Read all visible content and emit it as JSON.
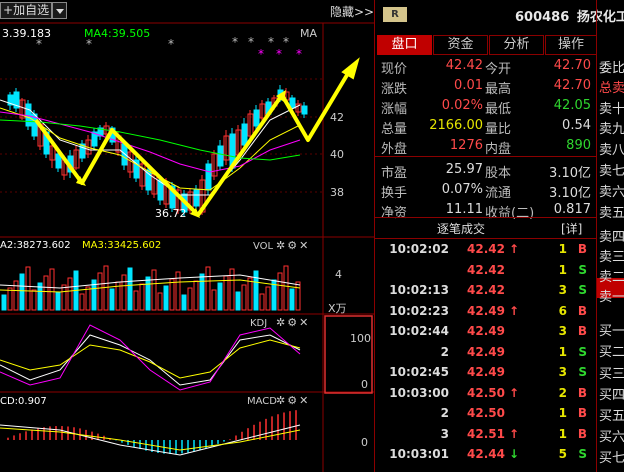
{
  "toolbar": {
    "add_label": "加自选",
    "hide_label": "隐藏>>"
  },
  "kline": {
    "legend_ma_left": "3.39.183",
    "legend_ma4": "MA4:39.505",
    "legend_ma": "MA",
    "price_ticks": [
      "42",
      "40",
      "38"
    ],
    "low_label": "36.72",
    "colors": {
      "ma1": "#ffffff",
      "ma2": "#ffff00",
      "ma3": "#ff00ff",
      "ma4": "#00ff00",
      "up": "#ff3030",
      "down": "#00e5ff",
      "arrow": "#ffff00"
    }
  },
  "volume": {
    "legend_a": "A2:38273.602",
    "legend_ma3": "MA3:33425.602",
    "title": "VOL",
    "axis_tick": "4",
    "unit": "X万"
  },
  "kdj": {
    "title": "KDJ",
    "axis_top": "100",
    "axis_bottom": "0"
  },
  "macd": {
    "legend": "CD:0.907",
    "title": "MACD",
    "axis_zero": "0"
  },
  "stock": {
    "badge": "R",
    "code": "600486",
    "name": "扬农化工"
  },
  "tabs": [
    "盘口",
    "资金",
    "分析",
    "操作"
  ],
  "quotes": [
    {
      "l1": "现价",
      "v1": "42.42",
      "c1": "red",
      "l2": "今开",
      "v2": "42.70",
      "c2": "red"
    },
    {
      "l1": "涨跌",
      "v1": "0.01",
      "c1": "red",
      "l2": "最高",
      "v2": "42.70",
      "c2": "red"
    },
    {
      "l1": "涨幅",
      "v1": "0.02%",
      "c1": "red",
      "l2": "最低",
      "v2": "42.05",
      "c2": "green"
    },
    {
      "l1": "总量",
      "v1": "2166.00",
      "c1": "yellow",
      "l2": "量比",
      "v2": "0.54",
      "c2": "white"
    },
    {
      "l1": "外盘",
      "v1": "1276",
      "c1": "red",
      "l2": "内盘",
      "v2": "890",
      "c2": "green"
    },
    {
      "l1": "市盈",
      "v1": "25.97",
      "c1": "white",
      "l2": "股本",
      "v2": "3.10亿",
      "c2": "white"
    },
    {
      "l1": "换手",
      "v1": "0.07%",
      "c1": "white",
      "l2": "流通",
      "v2": "3.10亿",
      "c2": "white"
    },
    {
      "l1": "净资",
      "v1": "11.11",
      "c1": "white",
      "l2": "收益(二)",
      "v2": "0.817",
      "c2": "white"
    }
  ],
  "ticks_header": {
    "title": "逐笔成交",
    "detail": "[详]"
  },
  "ticks": [
    {
      "time": "10:02:02",
      "price": "42.42",
      "dir": "↑",
      "vol": "1",
      "side": "B"
    },
    {
      "time": "",
      "price": "42.42",
      "dir": "",
      "vol": "1",
      "side": "S"
    },
    {
      "time": "10:02:13",
      "price": "42.42",
      "dir": "",
      "vol": "3",
      "side": "S"
    },
    {
      "time": "10:02:23",
      "price": "42.49",
      "dir": "↑",
      "vol": "6",
      "side": "B"
    },
    {
      "time": "10:02:44",
      "price": "42.49",
      "dir": "",
      "vol": "3",
      "side": "B"
    },
    {
      "time": "2",
      "price": "42.49",
      "dir": "",
      "vol": "1",
      "side": "S"
    },
    {
      "time": "10:02:45",
      "price": "42.49",
      "dir": "",
      "vol": "3",
      "side": "S"
    },
    {
      "time": "10:03:00",
      "price": "42.50",
      "dir": "↑",
      "vol": "2",
      "side": "B"
    },
    {
      "time": "2",
      "price": "42.50",
      "dir": "",
      "vol": "1",
      "side": "B"
    },
    {
      "time": "3",
      "price": "42.51",
      "dir": "↑",
      "vol": "1",
      "side": "B"
    },
    {
      "time": "10:03:01",
      "price": "42.44",
      "dir": "↓",
      "vol": "5",
      "side": "S"
    }
  ],
  "book": [
    "委比",
    "总卖",
    "卖十",
    "卖九",
    "卖八",
    "卖七",
    "卖六",
    "卖五",
    "卖四",
    "卖三",
    "卖二",
    "卖一",
    "",
    "买一",
    "买二",
    "买三",
    "买四",
    "买五",
    "买六",
    "买七"
  ]
}
